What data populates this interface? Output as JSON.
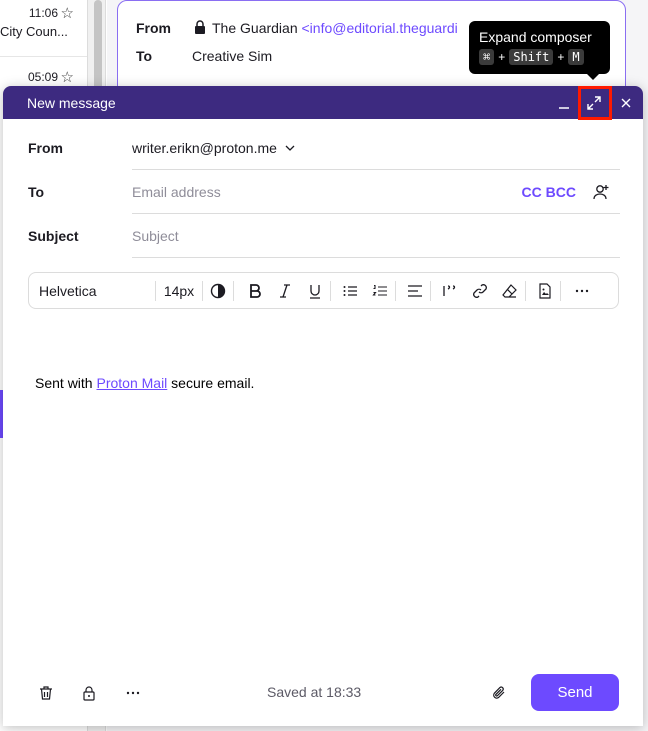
{
  "background": {
    "list_rows": [
      {
        "time": "11:06",
        "sender": "City Coun..."
      },
      {
        "time": "05:09",
        "sender": ""
      }
    ],
    "card": {
      "from_label": "From",
      "from_name": "The Guardian",
      "from_email": "<info@editorial.theguardi",
      "to_label": "To",
      "to_value": "Creative Sim"
    }
  },
  "composer": {
    "title": "New message",
    "from_label": "From",
    "from_value": "writer.erikn@proton.me",
    "to_label": "To",
    "to_placeholder": "Email address",
    "cc_bcc": "CC BCC",
    "subject_label": "Subject",
    "subject_placeholder": "Subject",
    "toolbar": {
      "font": "Helvetica",
      "size": "14px"
    },
    "body": {
      "prefix": "Sent with ",
      "link": "Proton Mail",
      "suffix": " secure email."
    },
    "saved": "Saved at 18:33",
    "send": "Send"
  },
  "tooltip": {
    "title": "Expand composer",
    "key1": "⌘",
    "plus": "+",
    "key2": "Shift",
    "key3": "M"
  },
  "colors": {
    "titlebar": "#3d2a80",
    "accent": "#6d4aff",
    "highlight": "#ff1a00"
  }
}
